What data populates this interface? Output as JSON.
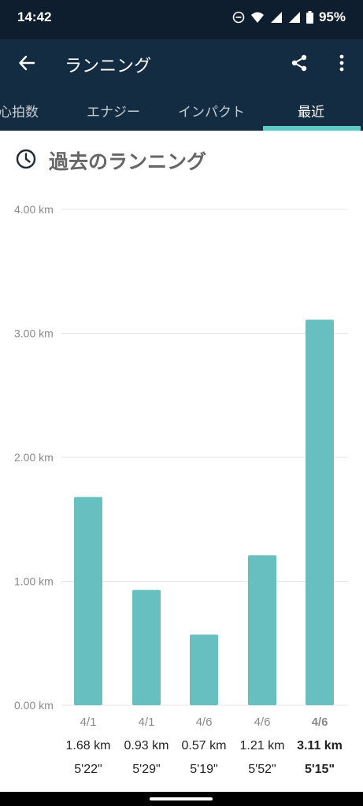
{
  "status": {
    "time": "14:42",
    "battery": "95%"
  },
  "appbar": {
    "title": "ランニング"
  },
  "tabs": [
    {
      "label": "心拍数",
      "active": false
    },
    {
      "label": "エナジー",
      "active": false
    },
    {
      "label": "インパクト",
      "active": false
    },
    {
      "label": "最近",
      "active": true
    }
  ],
  "section": {
    "title": "過去のランニング"
  },
  "colors": {
    "bar": "#67bfbf",
    "appbar": "#142c41",
    "statusbar": "#0e1e2e",
    "accent": "#5fc7c4"
  },
  "chart_data": {
    "type": "bar",
    "unit": "km",
    "ylim": [
      0,
      4
    ],
    "y_ticks": [
      "0.00 km",
      "1.00 km",
      "2.00 km",
      "3.00 km",
      "4.00 km"
    ],
    "categories": [
      "4/1",
      "4/1",
      "4/6",
      "4/6",
      "4/6"
    ],
    "values": [
      1.68,
      0.93,
      0.57,
      1.21,
      3.11
    ],
    "distance_labels": [
      "1.68 km",
      "0.93 km",
      "0.57 km",
      "1.21 km",
      "3.11 km"
    ],
    "pace_labels": [
      "5'22\"",
      "5'29\"",
      "5'19\"",
      "5'52\"",
      "5'15\""
    ],
    "highlighted_index": 4,
    "grid": true
  }
}
